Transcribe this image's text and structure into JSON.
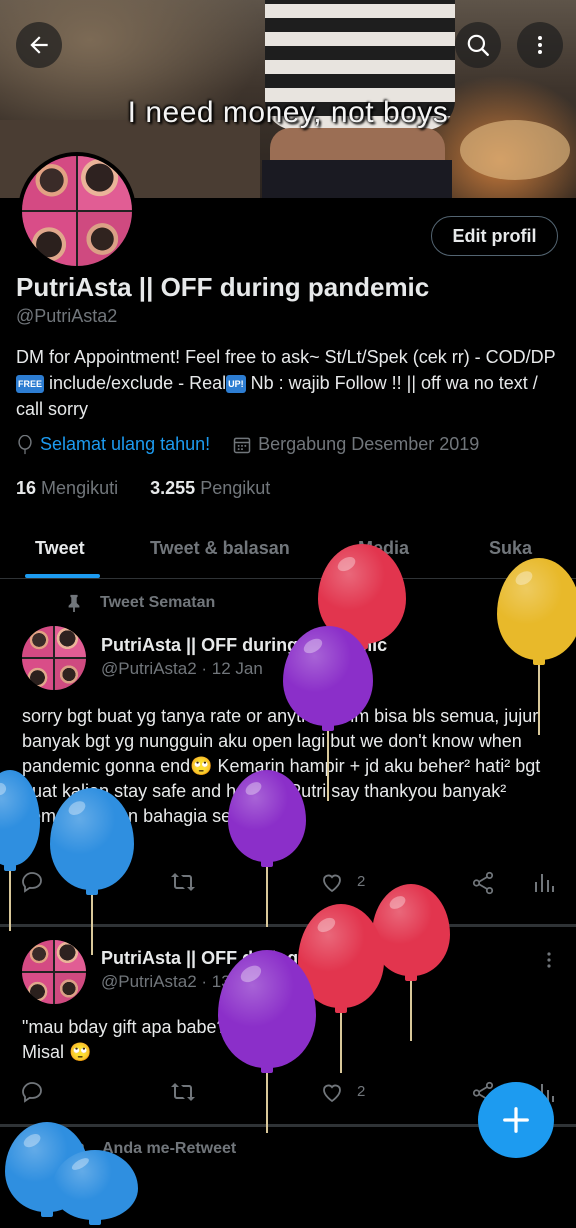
{
  "header": {
    "banner_caption": "I need money, not boys",
    "back_icon": "arrow-left-icon",
    "search_icon": "search-icon",
    "more_icon": "more-vertical-icon"
  },
  "profile": {
    "edit_label": "Edit profil",
    "display_name": "PutriAsta || OFF during pandemic",
    "handle": "@PutriAsta2",
    "bio_part1": "DM for Appointment! Feel free to ask~ St/Lt/Spek (cek rr) - COD/DP",
    "bio_badge_free": "FREE",
    "bio_part2": " include/exclude - Real",
    "bio_badge_up": "UP!",
    "bio_part3": " Nb : wajib Follow !! || off wa no text / call sorry",
    "birthday_text": "Selamat ulang tahun!",
    "joined_text": "Bergabung Desember 2019",
    "following_count": "16",
    "following_label": "Mengikuti",
    "followers_count": "3.255",
    "followers_label": "Pengikut"
  },
  "tabs": [
    {
      "label": "Tweet"
    },
    {
      "label": "Tweet & balasan"
    },
    {
      "label": "Media"
    },
    {
      "label": "Suka"
    }
  ],
  "tweets": [
    {
      "context": "Tweet Sematan",
      "name": "PutriAsta || OFF during pandemic",
      "handle_time": "@PutriAsta2 · 12 Jan",
      "text": "sorry bgt buat yg tanya rate or anything blm bisa bls semua, jujur banyak bgt yg nungguin aku open lagi but we don't know when pandemic gonna end🙄 Kemarin hampir + jd aku beher² hati² bgt buat kalian stay safe and healthy Putri say thankyou banyak² semoga kalian bahagia selalu🖤",
      "likes": "2"
    },
    {
      "name": "PutriAsta || OFF during pandemic",
      "handle_time": "@PutriAsta2 · 13 Jan",
      "text_line1": "\"mau bday gift apa babe?\"",
      "text_line2": "Misal 🙄",
      "likes": "2"
    },
    {
      "context": "Anda me-Retweet"
    }
  ],
  "colors": {
    "accent": "#1d9bf0",
    "balloon_red": "#e2354e",
    "balloon_purple": "#8b2fc9",
    "balloon_yellow": "#e8b92a",
    "balloon_blue": "#2f8fe0"
  }
}
